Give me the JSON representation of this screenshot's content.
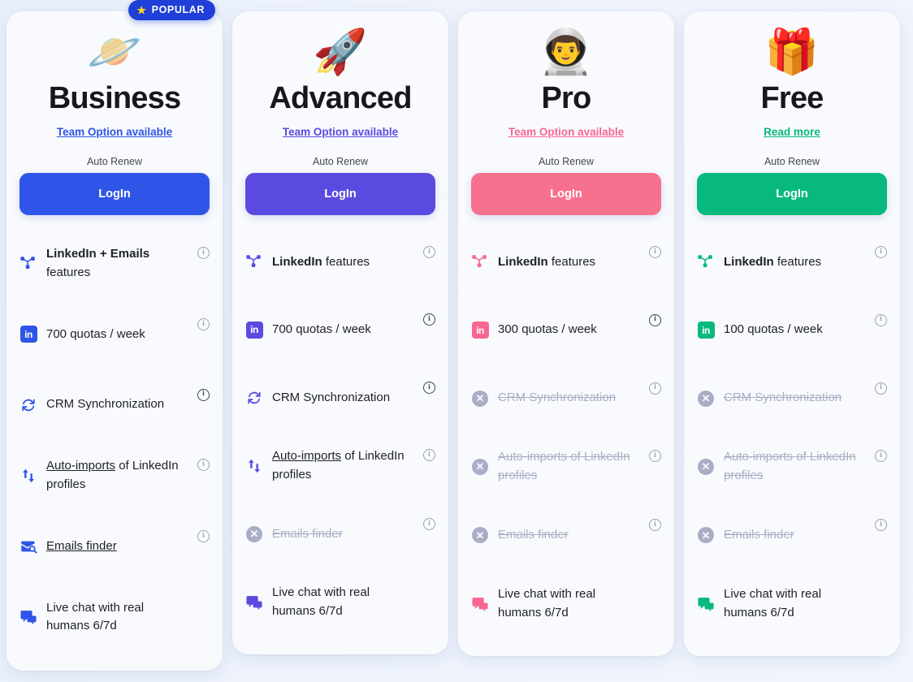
{
  "badge": {
    "label": "POPULAR",
    "icon": "star-icon",
    "color": "#1f3fd6"
  },
  "common": {
    "auto_renew_label": "Auto Renew",
    "login_label": "LogIn",
    "info_icon": "info-icon"
  },
  "plans": [
    {
      "id": "business",
      "name": "Business",
      "emoji": "🪐",
      "emoji_name": "planet-emoji",
      "link_label": "Team Option available",
      "accent": "#2f55e8",
      "link_color": "#2f55e8",
      "button_color": "#2f55e8",
      "popular": true,
      "features": [
        {
          "icon": "network-nodes-icon",
          "text": "LinkedIn + Emails features",
          "bold_part": "LinkedIn + Emails",
          "enabled": true,
          "info": true,
          "info_dark": false
        },
        {
          "icon": "linkedin-badge-icon",
          "text": "700 quotas / week",
          "enabled": true,
          "info": true,
          "info_dark": false
        },
        {
          "icon": "sync-icon",
          "text": "CRM Synchronization",
          "enabled": true,
          "info": true,
          "info_dark": true
        },
        {
          "icon": "auto-import-arrows-icon",
          "text": "Auto-imports of LinkedIn profiles",
          "underline_part": "Auto-imports",
          "enabled": true,
          "info": true,
          "info_dark": false
        },
        {
          "icon": "email-search-icon",
          "text": "Emails finder",
          "underline_part": "Emails finder",
          "enabled": true,
          "info": true,
          "info_dark": false
        },
        {
          "icon": "live-chat-icon",
          "text": "Live chat with real humans 6/7d",
          "enabled": true,
          "info": false,
          "info_dark": false
        }
      ]
    },
    {
      "id": "advanced",
      "name": "Advanced",
      "emoji": "🚀",
      "emoji_name": "rocket-emoji",
      "link_label": "Team Option available",
      "accent": "#5b4ae0",
      "link_color": "#5b4ae0",
      "button_color": "#5b4ae0",
      "popular": false,
      "features": [
        {
          "icon": "network-nodes-icon",
          "text": "LinkedIn features",
          "bold_part": "LinkedIn",
          "enabled": true,
          "info": true,
          "info_dark": false
        },
        {
          "icon": "linkedin-badge-icon",
          "text": "700 quotas / week",
          "enabled": true,
          "info": true,
          "info_dark": true
        },
        {
          "icon": "sync-icon",
          "text": "CRM Synchronization",
          "enabled": true,
          "info": true,
          "info_dark": true
        },
        {
          "icon": "auto-import-arrows-icon",
          "text": "Auto-imports of LinkedIn profiles",
          "underline_part": "Auto-imports",
          "enabled": true,
          "info": true,
          "info_dark": false
        },
        {
          "icon": "disabled-x-icon",
          "text": "Emails finder",
          "enabled": false,
          "info": true,
          "info_dark": false
        },
        {
          "icon": "live-chat-icon",
          "text": "Live chat with real humans 6/7d",
          "enabled": true,
          "info": false,
          "info_dark": false
        }
      ]
    },
    {
      "id": "pro",
      "name": "Pro",
      "emoji": "👨‍🚀",
      "emoji_name": "astronaut-helmet-emoji",
      "link_label": "Team Option available",
      "accent": "#f9668f",
      "link_color": "#f5partial",
      "button_color": "#f7718f",
      "popular": false,
      "features": [
        {
          "icon": "network-nodes-icon",
          "text": "LinkedIn features",
          "bold_part": "LinkedIn",
          "enabled": true,
          "info": true,
          "info_dark": false
        },
        {
          "icon": "linkedin-badge-icon",
          "text": "300 quotas / week",
          "enabled": true,
          "info": true,
          "info_dark": true
        },
        {
          "icon": "disabled-x-icon",
          "text": "CRM Synchronization",
          "enabled": false,
          "info": true,
          "info_dark": false
        },
        {
          "icon": "disabled-x-icon",
          "text": "Auto-imports of LinkedIn profiles",
          "enabled": false,
          "info": true,
          "info_dark": false
        },
        {
          "icon": "disabled-x-icon",
          "text": "Emails finder",
          "enabled": false,
          "info": true,
          "info_dark": false
        },
        {
          "icon": "live-chat-icon",
          "text": "Live chat with real humans 6/7d",
          "enabled": true,
          "info": false,
          "info_dark": false
        }
      ]
    },
    {
      "id": "free",
      "name": "Free",
      "emoji": "🎁",
      "emoji_name": "gift-emoji",
      "link_label": "Read more",
      "accent": "#07b97c",
      "link_color": "#07b97c",
      "button_color": "#07b97c",
      "popular": false,
      "features": [
        {
          "icon": "network-nodes-icon",
          "text": "LinkedIn features",
          "bold_part": "LinkedIn",
          "enabled": true,
          "info": true,
          "info_dark": false
        },
        {
          "icon": "linkedin-badge-icon",
          "text": "100 quotas / week",
          "enabled": true,
          "info": true,
          "info_dark": false
        },
        {
          "icon": "disabled-x-icon",
          "text": "CRM Synchronization",
          "enabled": false,
          "info": true,
          "info_dark": false
        },
        {
          "icon": "disabled-x-icon",
          "text": "Auto-imports of LinkedIn profiles",
          "enabled": false,
          "info": true,
          "info_dark": false
        },
        {
          "icon": "disabled-x-icon",
          "text": "Emails finder",
          "enabled": false,
          "info": true,
          "info_dark": false
        },
        {
          "icon": "live-chat-icon",
          "text": "Live chat with real humans 6/7d",
          "enabled": true,
          "info": false,
          "info_dark": false
        }
      ]
    }
  ]
}
